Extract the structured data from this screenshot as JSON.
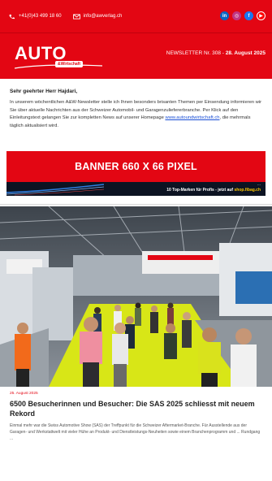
{
  "topbar": {
    "phone": "+41(0)43 499 18 60",
    "email": "info@awverlag.ch",
    "socials": [
      "linkedin-icon",
      "instagram-icon",
      "facebook-icon",
      "youtube-icon"
    ]
  },
  "header": {
    "logo_text": "AUTO",
    "logo_sub": "&Wirtschaft",
    "newsletter_label": "NEWSLETTER Nr. 308",
    "separator": "-",
    "newsletter_date": "28. August 2025"
  },
  "intro": {
    "greeting": "Sehr geehrter Herr Hajdari,",
    "text_before": "In unserem wöchentlichen A&W-Newsletter stelle ich Ihnen besonders brisanten Themen per Einsendung informieren wir Sie über aktuelle Nachrichten aus der Schweizer Automobil- und Garagenzuliefererbranche. Per Klick auf den Einleitungstext gelangen Sie zur kompletten News auf unserer Homepage",
    "link": "www.autoundwirtschaft.ch",
    "text_after": ", die mehrmals täglich aktualisiert wird."
  },
  "banner": {
    "label": "BANNER 660 X 66 PIXEL"
  },
  "ad": {
    "line1": "...",
    "line2_prefix": "10 Top-Marken für Profis - jetzt auf",
    "line2_highlight": "shop.fibag.ch"
  },
  "article": {
    "date": "25. August 2025",
    "title": "6500 Besucherinnen und Besucher: Die SAS 2025 schliesst mit neuem Rekord",
    "lead": "Einmal mehr war die Swiss Automotive Show (SAS) der Treffpunkt für die Schweizer Aftermarket-Branche. Für Ausstellende aus der Garagen- und Werkstattwelt mit vieler Hühe an Produkt- und Dienstleistungs-Neuheiten sowie einem Branchenprogramm und ... Rundgang ..."
  },
  "colors": {
    "brand_red": "#e30613",
    "link_blue": "#1a4fd6",
    "floor_yellow": "#d8e617"
  }
}
